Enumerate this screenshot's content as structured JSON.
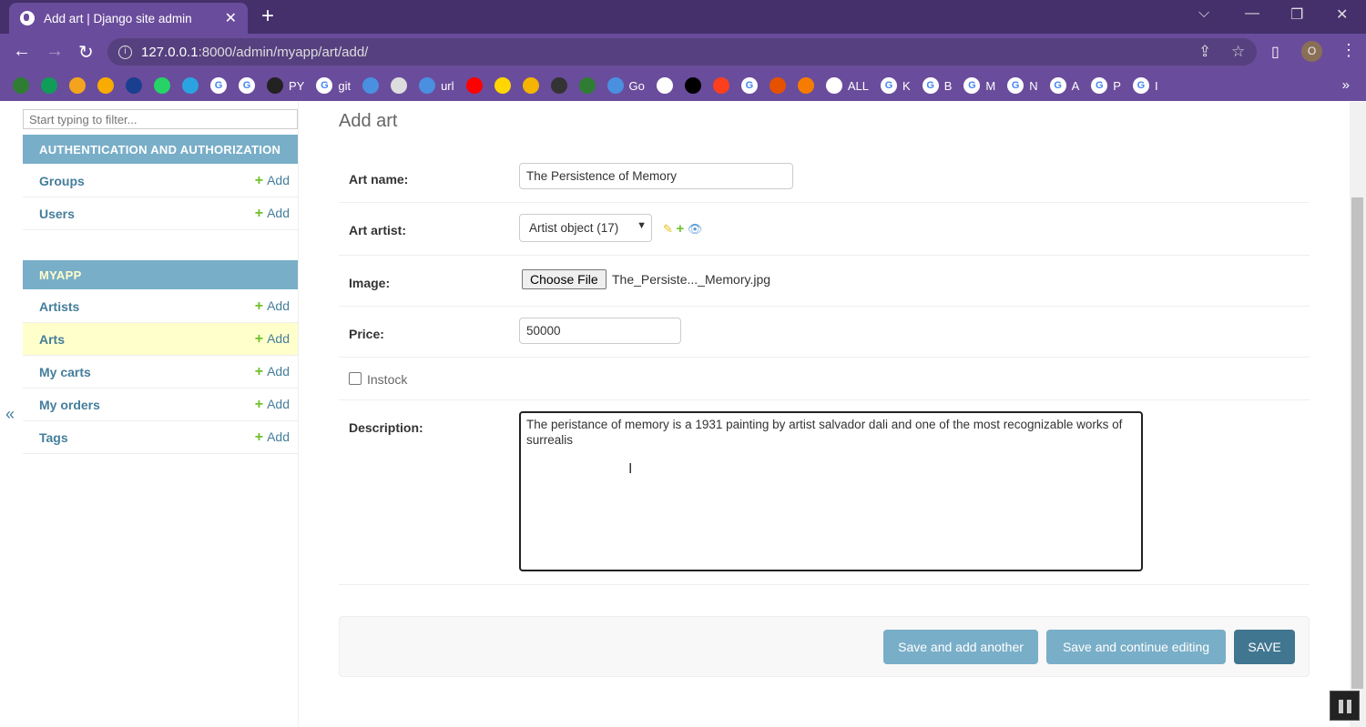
{
  "browser": {
    "tab_title": "Add art | Django site admin",
    "url_host": "127.0.0.1",
    "url_rest": ":8000/admin/myapp/art/add/",
    "profile_initial": "O",
    "bookmarks": [
      {
        "icon": "bookmark-icon",
        "label": "",
        "color": "#2e7d32"
      },
      {
        "icon": "bookmark-icon",
        "label": "",
        "color": "#0f9d58"
      },
      {
        "icon": "bookmark-icon",
        "label": "",
        "color": "#f4a41c"
      },
      {
        "icon": "analytics-icon",
        "label": "",
        "color": "#f9ab00"
      },
      {
        "icon": "ieee-icon",
        "label": "",
        "color": "#1a3f8f"
      },
      {
        "icon": "whatsapp-icon",
        "label": "",
        "color": "#25d366"
      },
      {
        "icon": "telegram-icon",
        "label": "",
        "color": "#2aa3e0"
      },
      {
        "icon": "google-icon",
        "label": "",
        "color": "#ffffff"
      },
      {
        "icon": "google-icon",
        "label": "",
        "color": "#ffffff"
      },
      {
        "icon": "github-icon",
        "label": "PY",
        "color": "#222222"
      },
      {
        "icon": "google-icon",
        "label": "git",
        "color": "#ffffff"
      },
      {
        "icon": "bookmark-icon",
        "label": "",
        "color": "#4a8fe0"
      },
      {
        "icon": "store-icon",
        "label": "",
        "color": "#dddddd"
      },
      {
        "icon": "wifi-icon",
        "label": "url",
        "color": "#4a8fe0"
      },
      {
        "icon": "youtube-icon",
        "label": "",
        "color": "#ff0000"
      },
      {
        "icon": "bookmark-icon",
        "label": "",
        "color": "#ffd600"
      },
      {
        "icon": "camera-icon",
        "label": "",
        "color": "#f4b400"
      },
      {
        "icon": "bookmark-icon",
        "label": "",
        "color": "#333333"
      },
      {
        "icon": "circle-icon",
        "label": "",
        "color": "#2e7d32"
      },
      {
        "icon": "bookmark-icon",
        "label": "Go",
        "color": "#4a8fe0"
      },
      {
        "icon": "bookmark-icon",
        "label": "",
        "color": "#ffffff"
      },
      {
        "icon": "bookmark-icon",
        "label": "",
        "color": "#000000"
      },
      {
        "icon": "yandex-icon",
        "label": "",
        "color": "#fc3f1d"
      },
      {
        "icon": "google-icon",
        "label": "",
        "color": "#ffffff"
      },
      {
        "icon": "bookmark-icon",
        "label": "",
        "color": "#e65100"
      },
      {
        "icon": "eye-icon",
        "label": "",
        "color": "#f57c00"
      },
      {
        "icon": "globe-icon",
        "label": "ALL",
        "color": "#ffffff"
      },
      {
        "icon": "google-icon",
        "label": "K",
        "color": "#ffffff"
      },
      {
        "icon": "google-icon",
        "label": "B",
        "color": "#ffffff"
      },
      {
        "icon": "google-icon",
        "label": "M",
        "color": "#ffffff"
      },
      {
        "icon": "google-icon",
        "label": "N",
        "color": "#ffffff"
      },
      {
        "icon": "google-icon",
        "label": "A",
        "color": "#ffffff"
      },
      {
        "icon": "google-icon",
        "label": "P",
        "color": "#ffffff"
      },
      {
        "icon": "google-icon",
        "label": "I",
        "color": "#ffffff"
      }
    ]
  },
  "sidebar": {
    "filter_placeholder": "Start typing to filter...",
    "add_label": "Add",
    "modules": [
      {
        "title": "AUTHENTICATION AND AUTHORIZATION",
        "items": [
          "Groups",
          "Users"
        ]
      },
      {
        "title": "MYAPP",
        "items": [
          "Artists",
          "Arts",
          "My carts",
          "My orders",
          "Tags"
        ]
      }
    ],
    "collapse": "«"
  },
  "form": {
    "title": "Add art",
    "art_name_label": "Art name:",
    "art_name_value": "The Persistence of Memory",
    "art_artist_label": "Art artist:",
    "art_artist_value": "Artist object (17)",
    "image_label": "Image:",
    "choose_file": "Choose File",
    "file_name": "The_Persiste..._Memory.jpg",
    "price_label": "Price:",
    "price_value": "50000",
    "instock_label": "Instock",
    "description_label": "Description:",
    "description_value": "The peristance of memory is a 1931 painting by artist salvador dali and one of the most recognizable works of surrealis",
    "buttons": {
      "save_add": "Save and add another",
      "save_continue": "Save and continue editing",
      "save": "SAVE"
    }
  },
  "colors": {
    "module_header": "#79aec8",
    "link": "#447e9b",
    "save": "#417690",
    "selected_row": "#ffffcc"
  }
}
